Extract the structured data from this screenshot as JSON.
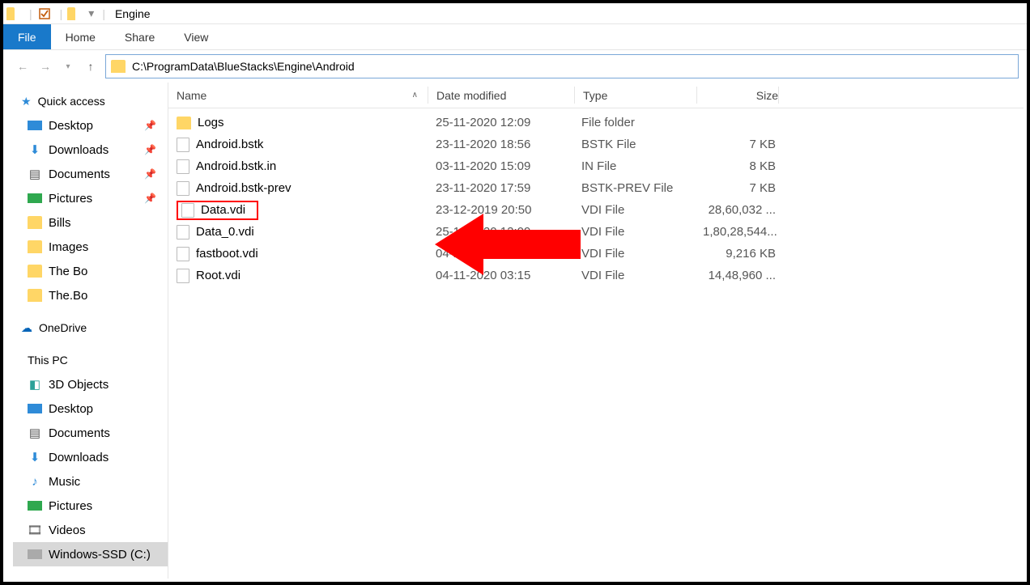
{
  "titlebar": {
    "title": "Engine"
  },
  "menubar": {
    "file": "File",
    "home": "Home",
    "share": "Share",
    "view": "View"
  },
  "address": {
    "path": "C:\\ProgramData\\BlueStacks\\Engine\\Android"
  },
  "columns": {
    "name": "Name",
    "date": "Date modified",
    "type": "Type",
    "size": "Size"
  },
  "sidebar": {
    "quick": "Quick access",
    "quick_items": [
      {
        "label": "Desktop",
        "icon": "desktop",
        "pinned": true
      },
      {
        "label": "Downloads",
        "icon": "downloads",
        "pinned": true
      },
      {
        "label": "Documents",
        "icon": "documents",
        "pinned": true
      },
      {
        "label": "Pictures",
        "icon": "pictures",
        "pinned": true
      },
      {
        "label": "Bills",
        "icon": "folder",
        "pinned": false
      },
      {
        "label": "Images",
        "icon": "folder",
        "pinned": false
      },
      {
        "label": "The Bo",
        "icon": "folder",
        "pinned": false
      },
      {
        "label": "The.Bo",
        "icon": "folder",
        "pinned": false
      }
    ],
    "onedrive": "OneDrive",
    "thispc": "This PC",
    "pc_items": [
      {
        "label": "3D Objects"
      },
      {
        "label": "Desktop"
      },
      {
        "label": "Documents"
      },
      {
        "label": "Downloads"
      },
      {
        "label": "Music"
      },
      {
        "label": "Pictures"
      },
      {
        "label": "Videos"
      },
      {
        "label": "Windows-SSD (C:)",
        "selected": true
      }
    ]
  },
  "files": [
    {
      "name": "Logs",
      "date": "25-11-2020 12:09",
      "type": "File folder",
      "size": "",
      "icon": "folder"
    },
    {
      "name": "Android.bstk",
      "date": "23-11-2020 18:56",
      "type": "BSTK File",
      "size": "7 KB",
      "icon": "file"
    },
    {
      "name": "Android.bstk.in",
      "date": "03-11-2020 15:09",
      "type": "IN File",
      "size": "8 KB",
      "icon": "file"
    },
    {
      "name": "Android.bstk-prev",
      "date": "23-11-2020 17:59",
      "type": "BSTK-PREV File",
      "size": "7 KB",
      "icon": "file"
    },
    {
      "name": "Data.vdi",
      "date": "23-12-2019 20:50",
      "type": "VDI File",
      "size": "28,60,032 ...",
      "icon": "file",
      "highlight": true
    },
    {
      "name": "Data_0.vdi",
      "date": "25-11-2020 12:09",
      "type": "VDI File",
      "size": "1,80,28,544...",
      "icon": "file"
    },
    {
      "name": "fastboot.vdi",
      "date": "04-11-2020 03:11",
      "type": "VDI File",
      "size": "9,216 KB",
      "icon": "file"
    },
    {
      "name": "Root.vdi",
      "date": "04-11-2020 03:15",
      "type": "VDI File",
      "size": "14,48,960 ...",
      "icon": "file"
    }
  ],
  "annotation": {
    "arrow_points_to": "Data.vdi"
  }
}
